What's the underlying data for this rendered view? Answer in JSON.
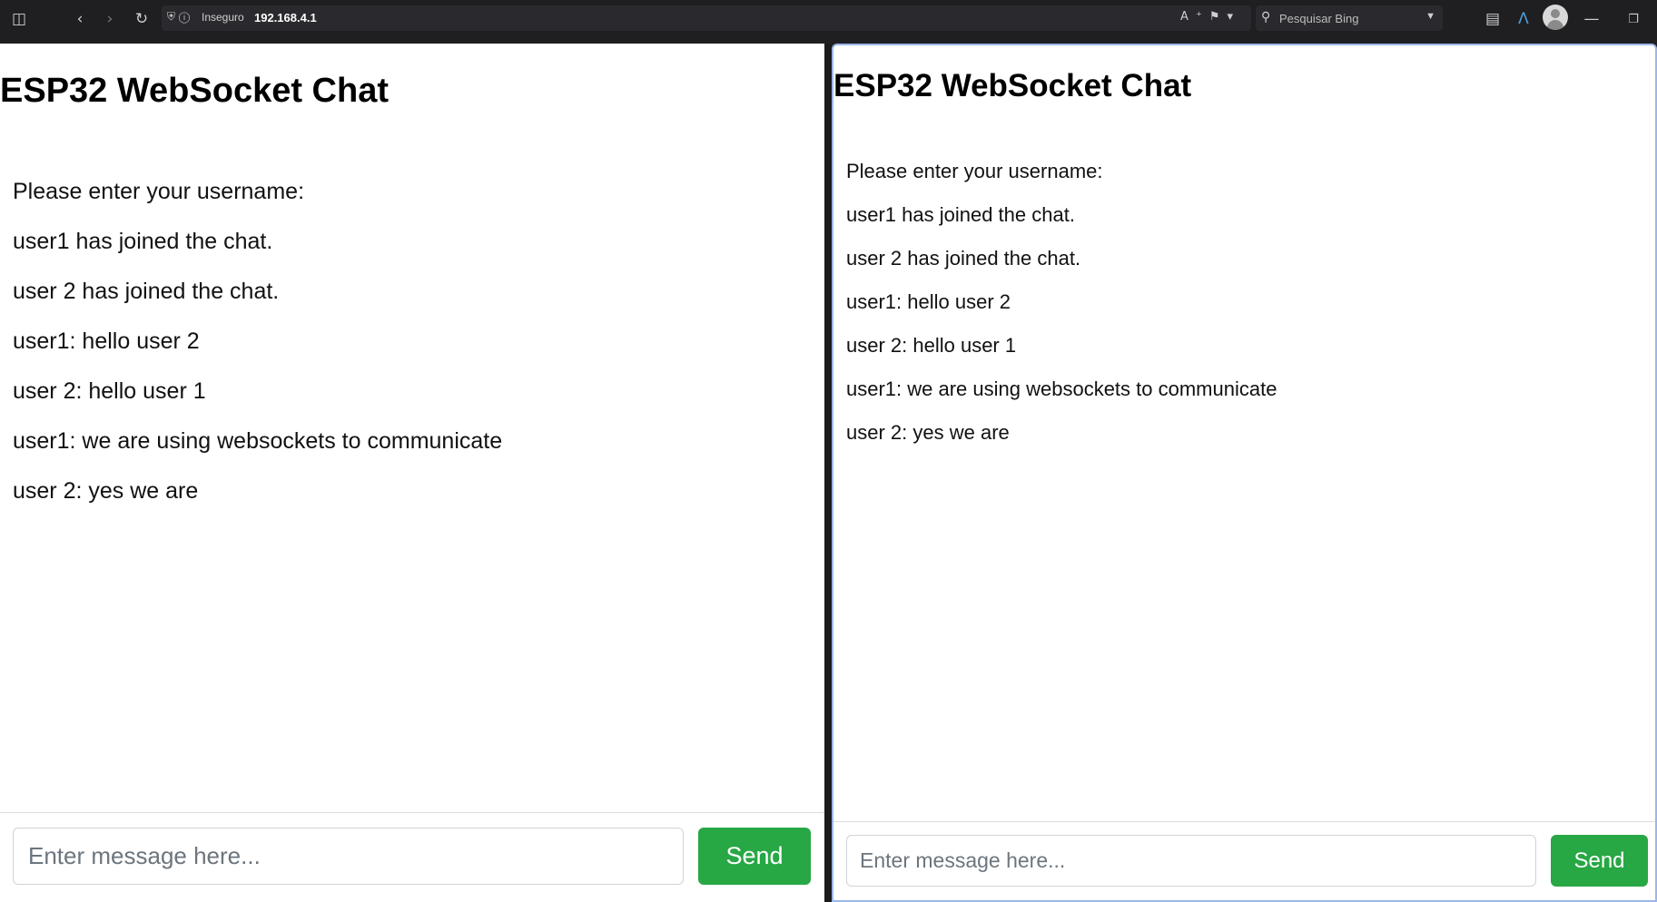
{
  "browser": {
    "security_label": "Inseguro",
    "url": "192.168.4.1",
    "search_placeholder": "Pesquisar Bing",
    "icons": {
      "sidebar": "sidebar-toggle-icon",
      "back": "back-icon",
      "forward": "forward-icon",
      "reload": "reload-icon",
      "shield": "shield-icon",
      "info": "info-icon",
      "read_aloud": "read-aloud-icon",
      "favorite": "favorite-icon",
      "search": "search-icon",
      "collections": "collections-icon",
      "extension": "extension-icon",
      "profile": "profile-avatar",
      "minimize": "minimize-icon",
      "restore": "restore-icon"
    }
  },
  "left_pane": {
    "title": "ESP32 WebSocket Chat",
    "messages": [
      "Please enter your username:",
      "user1 has joined the chat.",
      "user 2 has joined the chat.",
      "user1: hello user 2",
      "user 2: hello user 1",
      "user1: we are using websockets to communicate",
      "user 2: yes we are"
    ],
    "input_placeholder": "Enter message here...",
    "send_label": "Send"
  },
  "right_pane": {
    "title": "ESP32 WebSocket Chat",
    "messages": [
      "Please enter your username:",
      "user1 has joined the chat.",
      "user 2 has joined the chat.",
      "user1: hello user 2",
      "user 2: hello user 1",
      "user1: we are using websockets to communicate",
      "user 2: yes we are"
    ],
    "input_placeholder": "Enter message here...",
    "send_label": "Send"
  },
  "colors": {
    "send_button": "#28a745",
    "toolbar_bg": "#1f1f22",
    "active_pane_border": "#9ab7e8"
  }
}
